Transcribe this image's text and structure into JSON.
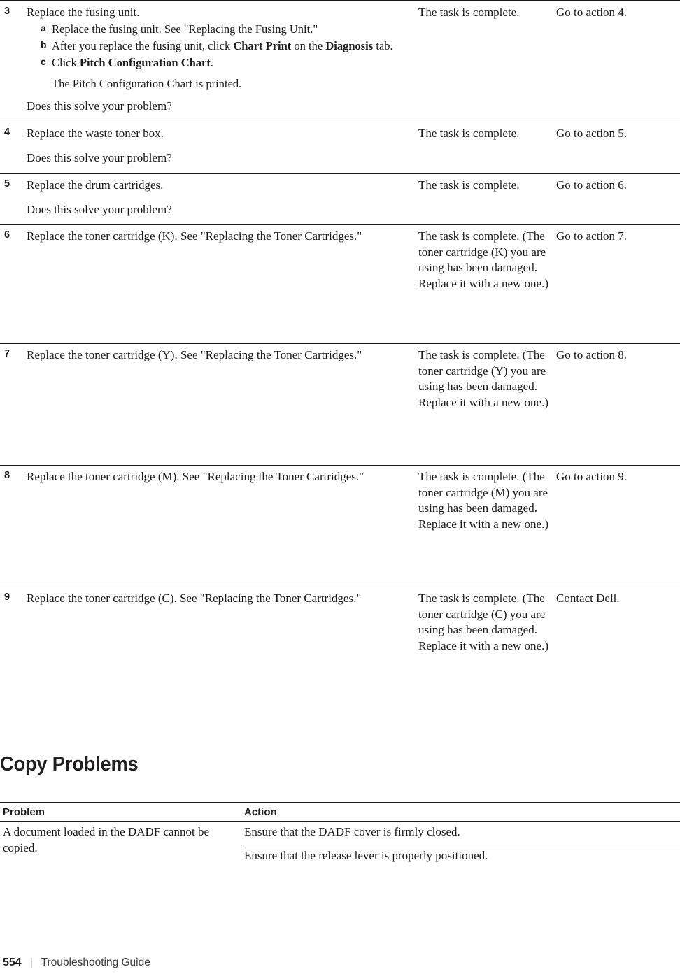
{
  "document": {
    "footer": {
      "page_number": "554",
      "separator": "|",
      "title": "Troubleshooting Guide"
    }
  },
  "action_table": {
    "rows": [
      {
        "number": "3",
        "action_lead": "Replace the fusing unit.",
        "substeps": [
          {
            "letter": "a",
            "text_before": "Replace the fusing unit. See \"Replacing the Fusing Unit.\"",
            "bold1": "",
            "text_mid": "",
            "bold2": "",
            "text_after": ""
          },
          {
            "letter": "b",
            "text_before": "After you replace the fusing unit, click ",
            "bold1": "Chart Print",
            "text_mid": " on the ",
            "bold2": "Diagnosis",
            "text_after": " tab."
          },
          {
            "letter": "c",
            "text_before": "Click ",
            "bold1": "Pitch Configuration Chart",
            "text_mid": ".",
            "bold2": "",
            "text_after": ""
          }
        ],
        "sub_note": "The Pitch Configuration Chart is printed.",
        "question": "Does this solve your problem?",
        "yes": "The task is complete.",
        "no": "Go to action 4."
      },
      {
        "number": "4",
        "action_lead": "Replace the waste toner box.",
        "question": "Does this solve your problem?",
        "yes": "The task is complete.",
        "no": "Go to action 5."
      },
      {
        "number": "5",
        "action_lead": "Replace the drum cartridges.",
        "question": "Does this solve your problem?",
        "yes": "The task is complete.",
        "no": "Go to action 6."
      },
      {
        "number": "6",
        "action_lead": "Replace the toner cartridge (K). See \"Replacing the Toner Cartridges.\"",
        "yes": "The task is complete. (The toner cartridge (K) you are using has been damaged. Replace it with a new one.)",
        "no": "Go to action 7."
      },
      {
        "number": "7",
        "action_lead": "Replace the toner cartridge (Y). See \"Replacing the Toner Cartridges.\"",
        "yes": "The task is complete. (The toner cartridge (Y) you are using has been damaged. Replace it with a new one.)",
        "no": "Go to action 8."
      },
      {
        "number": "8",
        "action_lead": "Replace the toner cartridge (M). See \"Replacing the Toner Cartridges.\"",
        "yes": "The task is complete. (The toner cartridge (M) you are using has been damaged. Replace it with a new one.)",
        "no": "Go to action 9."
      },
      {
        "number": "9",
        "action_lead": "Replace the toner cartridge (C). See \"Replacing the Toner Cartridges.\"",
        "yes": "The task is complete. (The toner cartridge (C) you are using has been damaged. Replace it with a new one.)",
        "no": "Contact Dell."
      }
    ]
  },
  "copy_problems": {
    "heading": "Copy Problems",
    "headers": {
      "problem": "Problem",
      "action": "Action"
    },
    "rows": [
      {
        "problem": "A document loaded in the DADF cannot be copied.",
        "actions": [
          "Ensure that the DADF cover is firmly closed.",
          "Ensure that the release lever is properly positioned."
        ]
      }
    ]
  }
}
